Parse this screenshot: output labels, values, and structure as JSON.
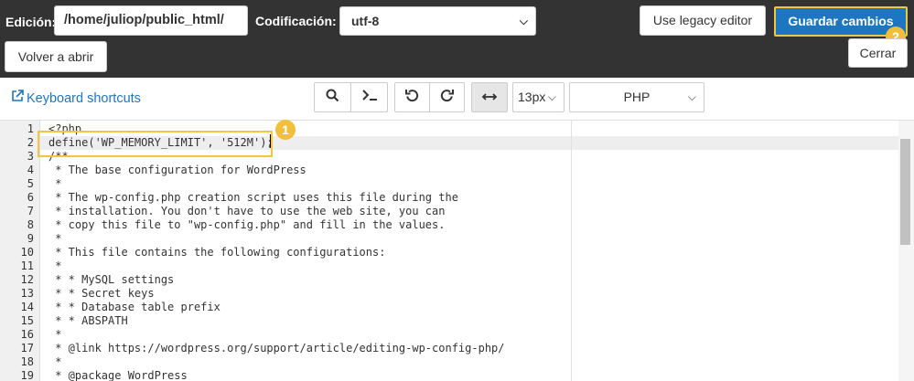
{
  "header": {
    "edicion_label": "Edición:",
    "path_value": "/home/juliop/public_html/",
    "codificacion_label": "Codificación:",
    "encoding_value": "utf-8",
    "legacy_button": "Use legacy editor",
    "save_button": "Guardar cambios",
    "reopen_button": "Volver a abrir",
    "close_button": "Cerrar",
    "badge_1": "1",
    "badge_2": "2"
  },
  "toolbar": {
    "keyboard_shortcuts": "Keyboard shortcuts",
    "font_size": "13px",
    "language": "PHP",
    "icons": [
      "search-icon",
      "terminal-icon",
      "undo-icon",
      "redo-icon",
      "wrap-icon"
    ]
  },
  "editor": {
    "lines": [
      {
        "n": "1",
        "text": "<?php"
      },
      {
        "n": "2",
        "text": "define('WP_MEMORY_LIMIT', '512M');"
      },
      {
        "n": "3",
        "text": "/**"
      },
      {
        "n": "4",
        "text": " * The base configuration for WordPress"
      },
      {
        "n": "5",
        "text": " *"
      },
      {
        "n": "6",
        "text": " * The wp-config.php creation script uses this file during the"
      },
      {
        "n": "7",
        "text": " * installation. You don't have to use the web site, you can"
      },
      {
        "n": "8",
        "text": " * copy this file to \"wp-config.php\" and fill in the values."
      },
      {
        "n": "9",
        "text": " *"
      },
      {
        "n": "10",
        "text": " * This file contains the following configurations:"
      },
      {
        "n": "11",
        "text": " *"
      },
      {
        "n": "12",
        "text": " * * MySQL settings"
      },
      {
        "n": "13",
        "text": " * * Secret keys"
      },
      {
        "n": "14",
        "text": " * * Database table prefix"
      },
      {
        "n": "15",
        "text": " * * ABSPATH"
      },
      {
        "n": "16",
        "text": " *"
      },
      {
        "n": "17",
        "text": " * @link https://wordpress.org/support/article/editing-wp-config-php/"
      },
      {
        "n": "18",
        "text": " *"
      },
      {
        "n": "19",
        "text": " * @package WordPress"
      }
    ]
  },
  "colors": {
    "topbar": "#333333",
    "accent": "#1d76c0",
    "highlight": "#f4c542"
  }
}
